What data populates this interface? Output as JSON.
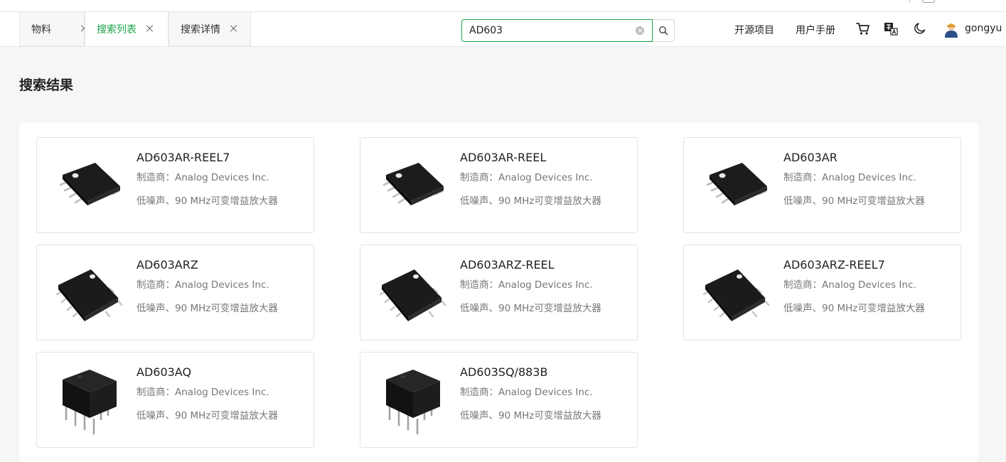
{
  "tabs": [
    {
      "label": "物料",
      "active": false
    },
    {
      "label": "搜索列表",
      "active": true
    },
    {
      "label": "搜索详情",
      "active": false
    }
  ],
  "search": {
    "value": "AD603",
    "placeholder": ""
  },
  "header": {
    "links": [
      "开源项目",
      "用户手册"
    ],
    "icons": [
      "cart-icon",
      "translate-icon",
      "dark-mode-icon"
    ],
    "user": {
      "name": "gongyu"
    }
  },
  "page": {
    "title": "搜索结果"
  },
  "colors": {
    "accent": "#1aa34a",
    "chip": "#1c1c1c"
  },
  "results": [
    {
      "name": "AD603AR-REEL7",
      "manufacturer": "制造商：Analog Devices Inc.",
      "description": "低噪声、90 MHz可变增益放大器",
      "package": "soic-flat"
    },
    {
      "name": "AD603AR-REEL",
      "manufacturer": "制造商：Analog Devices Inc.",
      "description": "低噪声、90 MHz可变增益放大器",
      "package": "soic-flat"
    },
    {
      "name": "AD603AR",
      "manufacturer": "制造商：Analog Devices Inc.",
      "description": "低噪声、90 MHz可变增益放大器",
      "package": "soic-flat"
    },
    {
      "name": "AD603ARZ",
      "manufacturer": "制造商：Analog Devices Inc.",
      "description": "低噪声、90 MHz可变增益放大器",
      "package": "soic-angled"
    },
    {
      "name": "AD603ARZ-REEL",
      "manufacturer": "制造商：Analog Devices Inc.",
      "description": "低噪声、90 MHz可变增益放大器",
      "package": "soic-angled"
    },
    {
      "name": "AD603ARZ-REEL7",
      "manufacturer": "制造商：Analog Devices Inc.",
      "description": "低噪声、90 MHz可变增益放大器",
      "package": "soic-angled"
    },
    {
      "name": "AD603AQ",
      "manufacturer": "制造商：Analog Devices Inc.",
      "description": "低噪声、90 MHz可变增益放大器",
      "package": "dip"
    },
    {
      "name": "AD603SQ/883B",
      "manufacturer": "制造商：Analog Devices Inc.",
      "description": "低噪声、90 MHz可变增益放大器",
      "package": "dip"
    }
  ]
}
